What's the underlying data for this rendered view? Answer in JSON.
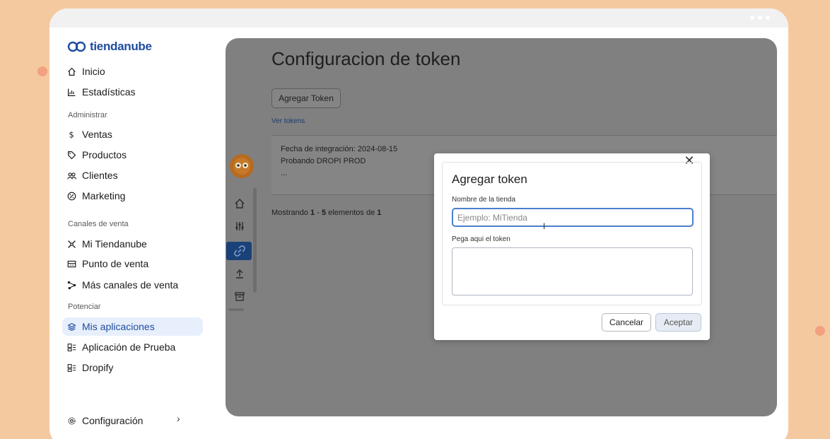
{
  "brand": {
    "logo_text": "tiendanube",
    "accent": "#1f4da0"
  },
  "sidebar": {
    "top_items": [
      {
        "label": "Inicio",
        "icon": "home-icon"
      },
      {
        "label": "Estadísticas",
        "icon": "bar-chart-icon"
      }
    ],
    "sections": [
      {
        "title": "Administrar",
        "items": [
          {
            "label": "Ventas",
            "icon": "dollar-icon"
          },
          {
            "label": "Productos",
            "icon": "tag-icon"
          },
          {
            "label": "Clientes",
            "icon": "users-icon"
          },
          {
            "label": "Marketing",
            "icon": "percent-icon"
          }
        ]
      },
      {
        "title": "Canales de venta",
        "items": [
          {
            "label": "Mi Tiendanube",
            "icon": "store-icon"
          },
          {
            "label": "Punto de venta",
            "icon": "pos-icon"
          },
          {
            "label": "Más canales de venta",
            "icon": "channels-icon"
          }
        ]
      },
      {
        "title": "Potenciar",
        "items": [
          {
            "label": "Mis aplicaciones",
            "icon": "apps-icon",
            "active": true
          },
          {
            "label": "Aplicación de Prueba",
            "icon": "app-icon"
          },
          {
            "label": "Dropify",
            "icon": "app-icon"
          }
        ]
      }
    ],
    "settings_label": "Configuración"
  },
  "main": {
    "title": "Configuracion de token",
    "add_button": "Agregar Token",
    "view_tokens_link": "Ver tokens",
    "card": {
      "line1": "Fecha de integración: 2024-08-15",
      "line2": "Probando DROPI PROD",
      "line3": "..."
    },
    "pagination": {
      "prefix": "Mostrando",
      "from": "1",
      "sep": "-",
      "to": "5",
      "middle": "elementos de",
      "total": "1"
    }
  },
  "modal": {
    "title": "Agregar token",
    "store_label": "Nombre de la tienda",
    "store_placeholder": "Ejemplo: MiTienda",
    "token_label": "Pega aqui el token",
    "cancel": "Cancelar",
    "accept": "Aceptar"
  }
}
